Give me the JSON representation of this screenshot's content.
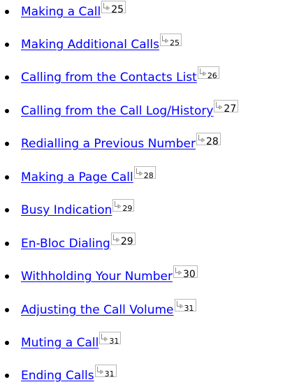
{
  "toc": {
    "items": [
      {
        "label": "Making a Call",
        "page": "25",
        "size": "big"
      },
      {
        "label": "Making Additional Calls",
        "page": "25",
        "size": "small"
      },
      {
        "label": "Calling from the Contacts List",
        "page": "26",
        "size": "small"
      },
      {
        "label": "Calling from the Call Log/History",
        "page": "27",
        "size": "big"
      },
      {
        "label": "Redialling a Previous Number",
        "page": "28",
        "size": "big"
      },
      {
        "label": "Making a Page Call",
        "page": "28",
        "size": "small"
      },
      {
        "label": "Busy Indication",
        "page": "29",
        "size": "small"
      },
      {
        "label": "En-Bloc Dialing",
        "page": "29",
        "size": "big"
      },
      {
        "label": "Withholding Your Number",
        "page": "30",
        "size": "big"
      },
      {
        "label": "Adjusting the Call Volume",
        "page": "31",
        "size": "small"
      },
      {
        "label": "Muting a Call",
        "page": "31",
        "size": "small"
      },
      {
        "label": "Ending Calls",
        "page": "31",
        "size": "small"
      }
    ]
  },
  "colors": {
    "link": "#0000ff",
    "bullet": "#000000",
    "page_ref_border": "#b8b8b8"
  },
  "icons": {
    "page_ref": "jump-arrow-icon",
    "bullet": "bullet-dot-icon"
  }
}
